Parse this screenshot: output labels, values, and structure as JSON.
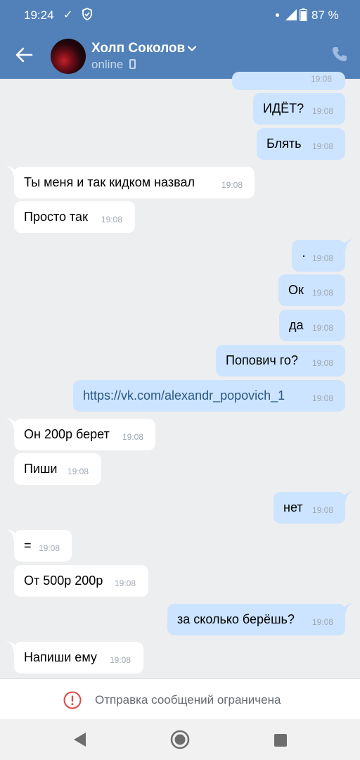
{
  "status_bar": {
    "time": "19:24",
    "battery": "87 %"
  },
  "header": {
    "name": "Холп Соколов",
    "presence": "online"
  },
  "messages": [
    {
      "dir": "out",
      "text": "",
      "time": "19:08"
    },
    {
      "dir": "out",
      "text": "ИДЁТ?",
      "time": "19:08"
    },
    {
      "dir": "out",
      "text": "Блять",
      "time": "19:08"
    },
    {
      "dir": "in",
      "text": "Ты меня и так кидком назвал",
      "time": "19:08"
    },
    {
      "dir": "in",
      "text": "Просто так",
      "time": "19:08"
    },
    {
      "dir": "out",
      "text": "·",
      "time": "19:08"
    },
    {
      "dir": "out",
      "text": "Ок",
      "time": "19:08"
    },
    {
      "dir": "out",
      "text": "да",
      "time": "19:08"
    },
    {
      "dir": "out",
      "text": "Попович го?",
      "time": "19:08"
    },
    {
      "dir": "out",
      "text": "https://vk.com/alexandr_popovich_1",
      "time": "19:08"
    },
    {
      "dir": "in",
      "text": "Он 200р берет",
      "time": "19:08"
    },
    {
      "dir": "in",
      "text": "Пиши",
      "time": "19:08"
    },
    {
      "dir": "out",
      "text": "нет",
      "time": "19:08"
    },
    {
      "dir": "in",
      "text": "=",
      "time": "19:08"
    },
    {
      "dir": "in",
      "text": "От 500р 200р",
      "time": "19:08"
    },
    {
      "dir": "out",
      "text": "за сколько берёшь?",
      "time": "19:08"
    },
    {
      "dir": "in",
      "text": "Напиши ему",
      "time": "19:08"
    }
  ],
  "restriction": {
    "text": "Отправка сообщений ограничена"
  },
  "colors": {
    "header": "#5181b8",
    "outgoing": "#cce4ff",
    "incoming": "#ffffff",
    "background": "#edeef0",
    "link": "#2a5885"
  }
}
